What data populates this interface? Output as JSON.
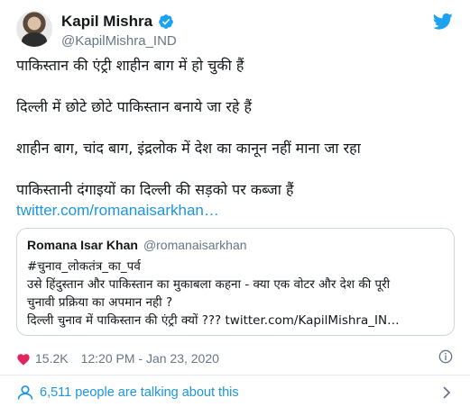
{
  "tweet": {
    "author_name": "Kapil Mishra",
    "author_handle": "@KapilMishra_IND",
    "lines": [
      "पाकिस्तान की एंट्री शाहीन बाग में हो चुकी हैं",
      "दिल्ली में छोटे छोटे पाकिस्तान बनाये जा रहे हैं",
      "शाहीन बाग, चांद बाग, इंद्रलोक में देश का कानून नहीं माना जा रहा",
      "पाकिस्तानी दंगाइयों का दिल्ली की सड़को पर कब्जा हैं"
    ],
    "link_text": "twitter.com/romanaisarkhan…",
    "likes": "15.2K",
    "timestamp": "12:20 PM - Jan 23, 2020"
  },
  "quoted": {
    "author_name": "Romana Isar Khan",
    "author_handle": "@romanaisarkhan",
    "lines": [
      "#चुनाव_लोकतंत्र_का_पर्व",
      "उसे हिंदुस्तान और पाकिस्तान का मुकाबला कहना - क्या एक वोटर और देश की पूरी",
      "चुनावी प्रक्रिया का अपमान नही ?",
      "दिल्ली चुनाव में पाकिस्तान की एंट्री क्यों ??? twitter.com/KapilMishra_IN…"
    ]
  },
  "footer": {
    "conversation_text": "6,511 people are talking about this"
  },
  "icons": {
    "verified": "verified-badge-icon",
    "twitter_bird": "twitter-bird-icon",
    "heart": "heart-icon",
    "info": "info-icon",
    "people": "person-icon",
    "chevron": "chevron-right-icon"
  },
  "colors": {
    "accent": "#1b95e0",
    "secondary_text": "#657786",
    "like_red": "#e0245e",
    "border": "#ccd6dd"
  }
}
